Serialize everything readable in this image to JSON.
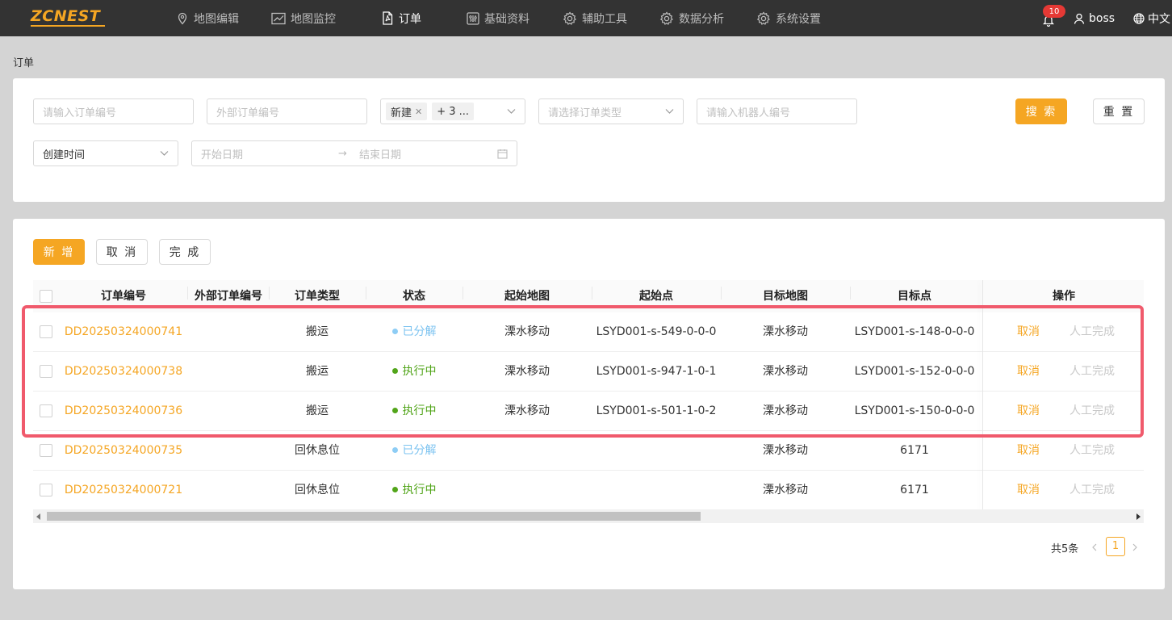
{
  "brand": {
    "logo_text": "ZCNEST"
  },
  "nav": [
    {
      "label": "地图编辑",
      "icon": "map-pin-icon"
    },
    {
      "label": "地图监控",
      "icon": "chart-line-icon"
    },
    {
      "label": "订单",
      "icon": "document-icon",
      "active": true
    },
    {
      "label": "基础资料",
      "icon": "settings-sliders-icon"
    },
    {
      "label": "辅助工具",
      "icon": "gear-icon"
    },
    {
      "label": "数据分析",
      "icon": "gear-icon"
    },
    {
      "label": "系统设置",
      "icon": "gear-icon"
    }
  ],
  "header_right": {
    "notification_count": "10",
    "user": "boss",
    "language": "中文"
  },
  "page_title": "订单",
  "filters": {
    "order_no_placeholder": "请输入订单编号",
    "external_order_no_placeholder": "外部订单编号",
    "status_tag": "新建",
    "status_more": "+ 3 ...",
    "order_type_placeholder": "请选择订单类型",
    "robot_no_placeholder": "请输入机器人编号",
    "search_label": "搜 索",
    "reset_label": "重 置",
    "time_type": "创建时间",
    "start_date_placeholder": "开始日期",
    "end_date_placeholder": "结束日期",
    "range_separator": "→"
  },
  "toolbar": {
    "add_label": "新 增",
    "cancel_label": "取 消",
    "complete_label": "完 成"
  },
  "table": {
    "columns": [
      "订单编号",
      "外部订单编号",
      "订单类型",
      "状态",
      "起始地图",
      "起始点",
      "目标地图",
      "目标点",
      "操作"
    ],
    "rows": [
      {
        "order_no": "DD20250324000741",
        "external_no": "",
        "type": "搬运",
        "status": "已分解",
        "status_color": "#8ecdf5",
        "start_map": "溧水移动",
        "start_point": "LSYD001-s-549-0-0-0",
        "target_map": "溧水移动",
        "target_point": "LSYD001-s-148-0-0-0",
        "action_cancel": "取消",
        "action_manual": "人工完成"
      },
      {
        "order_no": "DD20250324000738",
        "external_no": "",
        "type": "搬运",
        "status": "执行中",
        "status_color": "#52a51a",
        "start_map": "溧水移动",
        "start_point": "LSYD001-s-947-1-0-1",
        "target_map": "溧水移动",
        "target_point": "LSYD001-s-152-0-0-0",
        "action_cancel": "取消",
        "action_manual": "人工完成"
      },
      {
        "order_no": "DD20250324000736",
        "external_no": "",
        "type": "搬运",
        "status": "执行中",
        "status_color": "#52a51a",
        "start_map": "溧水移动",
        "start_point": "LSYD001-s-501-1-0-2",
        "target_map": "溧水移动",
        "target_point": "LSYD001-s-150-0-0-0",
        "action_cancel": "取消",
        "action_manual": "人工完成"
      },
      {
        "order_no": "DD20250324000735",
        "external_no": "",
        "type": "回休息位",
        "status": "已分解",
        "status_color": "#8ecdf5",
        "start_map": "",
        "start_point": "",
        "target_map": "溧水移动",
        "target_point": "6171",
        "action_cancel": "取消",
        "action_manual": "人工完成"
      },
      {
        "order_no": "DD20250324000721",
        "external_no": "",
        "type": "回休息位",
        "status": "执行中",
        "status_color": "#52a51a",
        "start_map": "",
        "start_point": "",
        "target_map": "溧水移动",
        "target_point": "6171",
        "action_cancel": "取消",
        "action_manual": "人工完成"
      }
    ]
  },
  "pagination": {
    "total": "共5条",
    "current_page": "1"
  },
  "colors": {
    "accent": "#f5a623",
    "topbar": "#333333",
    "highlight": "#f05a6c"
  }
}
